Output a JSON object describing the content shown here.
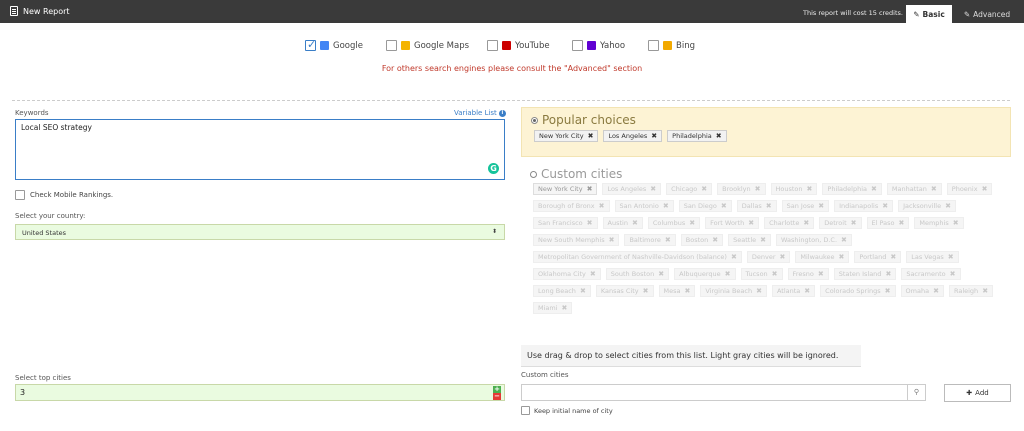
{
  "header": {
    "title": "New Report",
    "cost_text": "This report will cost 15 credits.",
    "tabs": [
      {
        "label": "Basic",
        "icon": "tag-icon",
        "active": true
      },
      {
        "label": "Advanced",
        "icon": "tags-icon",
        "active": false
      }
    ],
    "bg_color": "#3a3a3a"
  },
  "engines": [
    {
      "label": "Google",
      "checked": true,
      "icon": "google-icon",
      "color": "#4285f4"
    },
    {
      "label": "Google Maps",
      "checked": false,
      "icon": "google-maps-icon",
      "color": "#f4b400"
    },
    {
      "label": "YouTube",
      "checked": false,
      "icon": "youtube-icon",
      "color": "#cc0000"
    },
    {
      "label": "Yahoo",
      "checked": false,
      "icon": "yahoo-icon",
      "color": "#6001d2"
    },
    {
      "label": "Bing",
      "checked": false,
      "icon": "bing-icon",
      "color": "#f2a900"
    }
  ],
  "engines_notice": "For others search engines please consult the \"Advanced\" section",
  "keywords": {
    "label": "Keywords",
    "variable_list": "Variable List",
    "value": "Local SEO strategy"
  },
  "mobile": {
    "label": "Check Mobile Rankings.",
    "checked": false
  },
  "country": {
    "label": "Select your country:",
    "value": "United States"
  },
  "top_cities": {
    "label": "Select top cities",
    "value": "3"
  },
  "popular": {
    "title": "Popular choices",
    "chips": [
      "New York City",
      "Los Angeles",
      "Philadelphia"
    ]
  },
  "custom": {
    "title": "Custom cities",
    "chips": [
      "New York City",
      "Los Angeles",
      "Chicago",
      "Brooklyn",
      "Houston",
      "Philadelphia",
      "Manhattan",
      "Phoenix",
      "Borough of Bronx",
      "San Antonio",
      "San Diego",
      "Dallas",
      "San Jose",
      "Indianapolis",
      "Jacksonville",
      "San Francisco",
      "Austin",
      "Columbus",
      "Fort Worth",
      "Charlotte",
      "Detroit",
      "El Paso",
      "Memphis",
      "New South Memphis",
      "Baltimore",
      "Boston",
      "Seattle",
      "Washington, D.C.",
      "Metropolitan Government of Nashville-Davidson (balance)",
      "Denver",
      "Milwaukee",
      "Portland",
      "Las Vegas",
      "Oklahoma City",
      "South Boston",
      "Albuquerque",
      "Tucson",
      "Fresno",
      "Staten Island",
      "Sacramento",
      "Long Beach",
      "Kansas City",
      "Mesa",
      "Virginia Beach",
      "Atlanta",
      "Colorado Springs",
      "Omaha",
      "Raleigh",
      "Miami"
    ]
  },
  "hint": "Use drag & drop to select cities from this list. Light gray cities will be ignored.",
  "custom_input": {
    "label": "Custom cities",
    "placeholder": ""
  },
  "add_button": "Add",
  "keep_name": {
    "label": "Keep initial name of city",
    "checked": false
  }
}
